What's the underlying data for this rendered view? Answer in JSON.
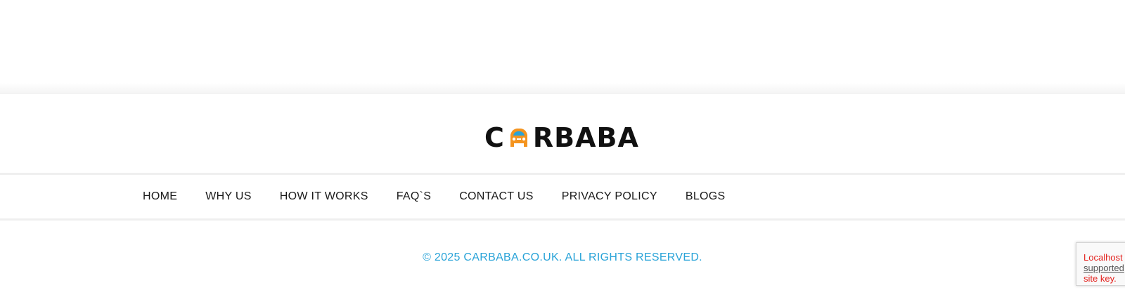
{
  "logo": {
    "letter_1": "C",
    "letters_rest": "RBABA",
    "car_icon": "car-icon",
    "car_color": "#f4941f",
    "car_glass_color": "#29a3d8"
  },
  "nav": {
    "items": [
      {
        "label": "HOME"
      },
      {
        "label": "WHY US"
      },
      {
        "label": "HOW IT WORKS"
      },
      {
        "label": "FAQ`S"
      },
      {
        "label": "CONTACT US"
      },
      {
        "label": "PRIVACY POLICY"
      },
      {
        "label": "BLOGS"
      }
    ]
  },
  "footer": {
    "copyright": "© 2025 CARBABA.CO.UK. ALL RIGHTS RESERVED.",
    "accent_color": "#29a3d8"
  },
  "recaptcha": {
    "line1": "Localhost",
    "line2": "supported",
    "line3": "site key."
  }
}
